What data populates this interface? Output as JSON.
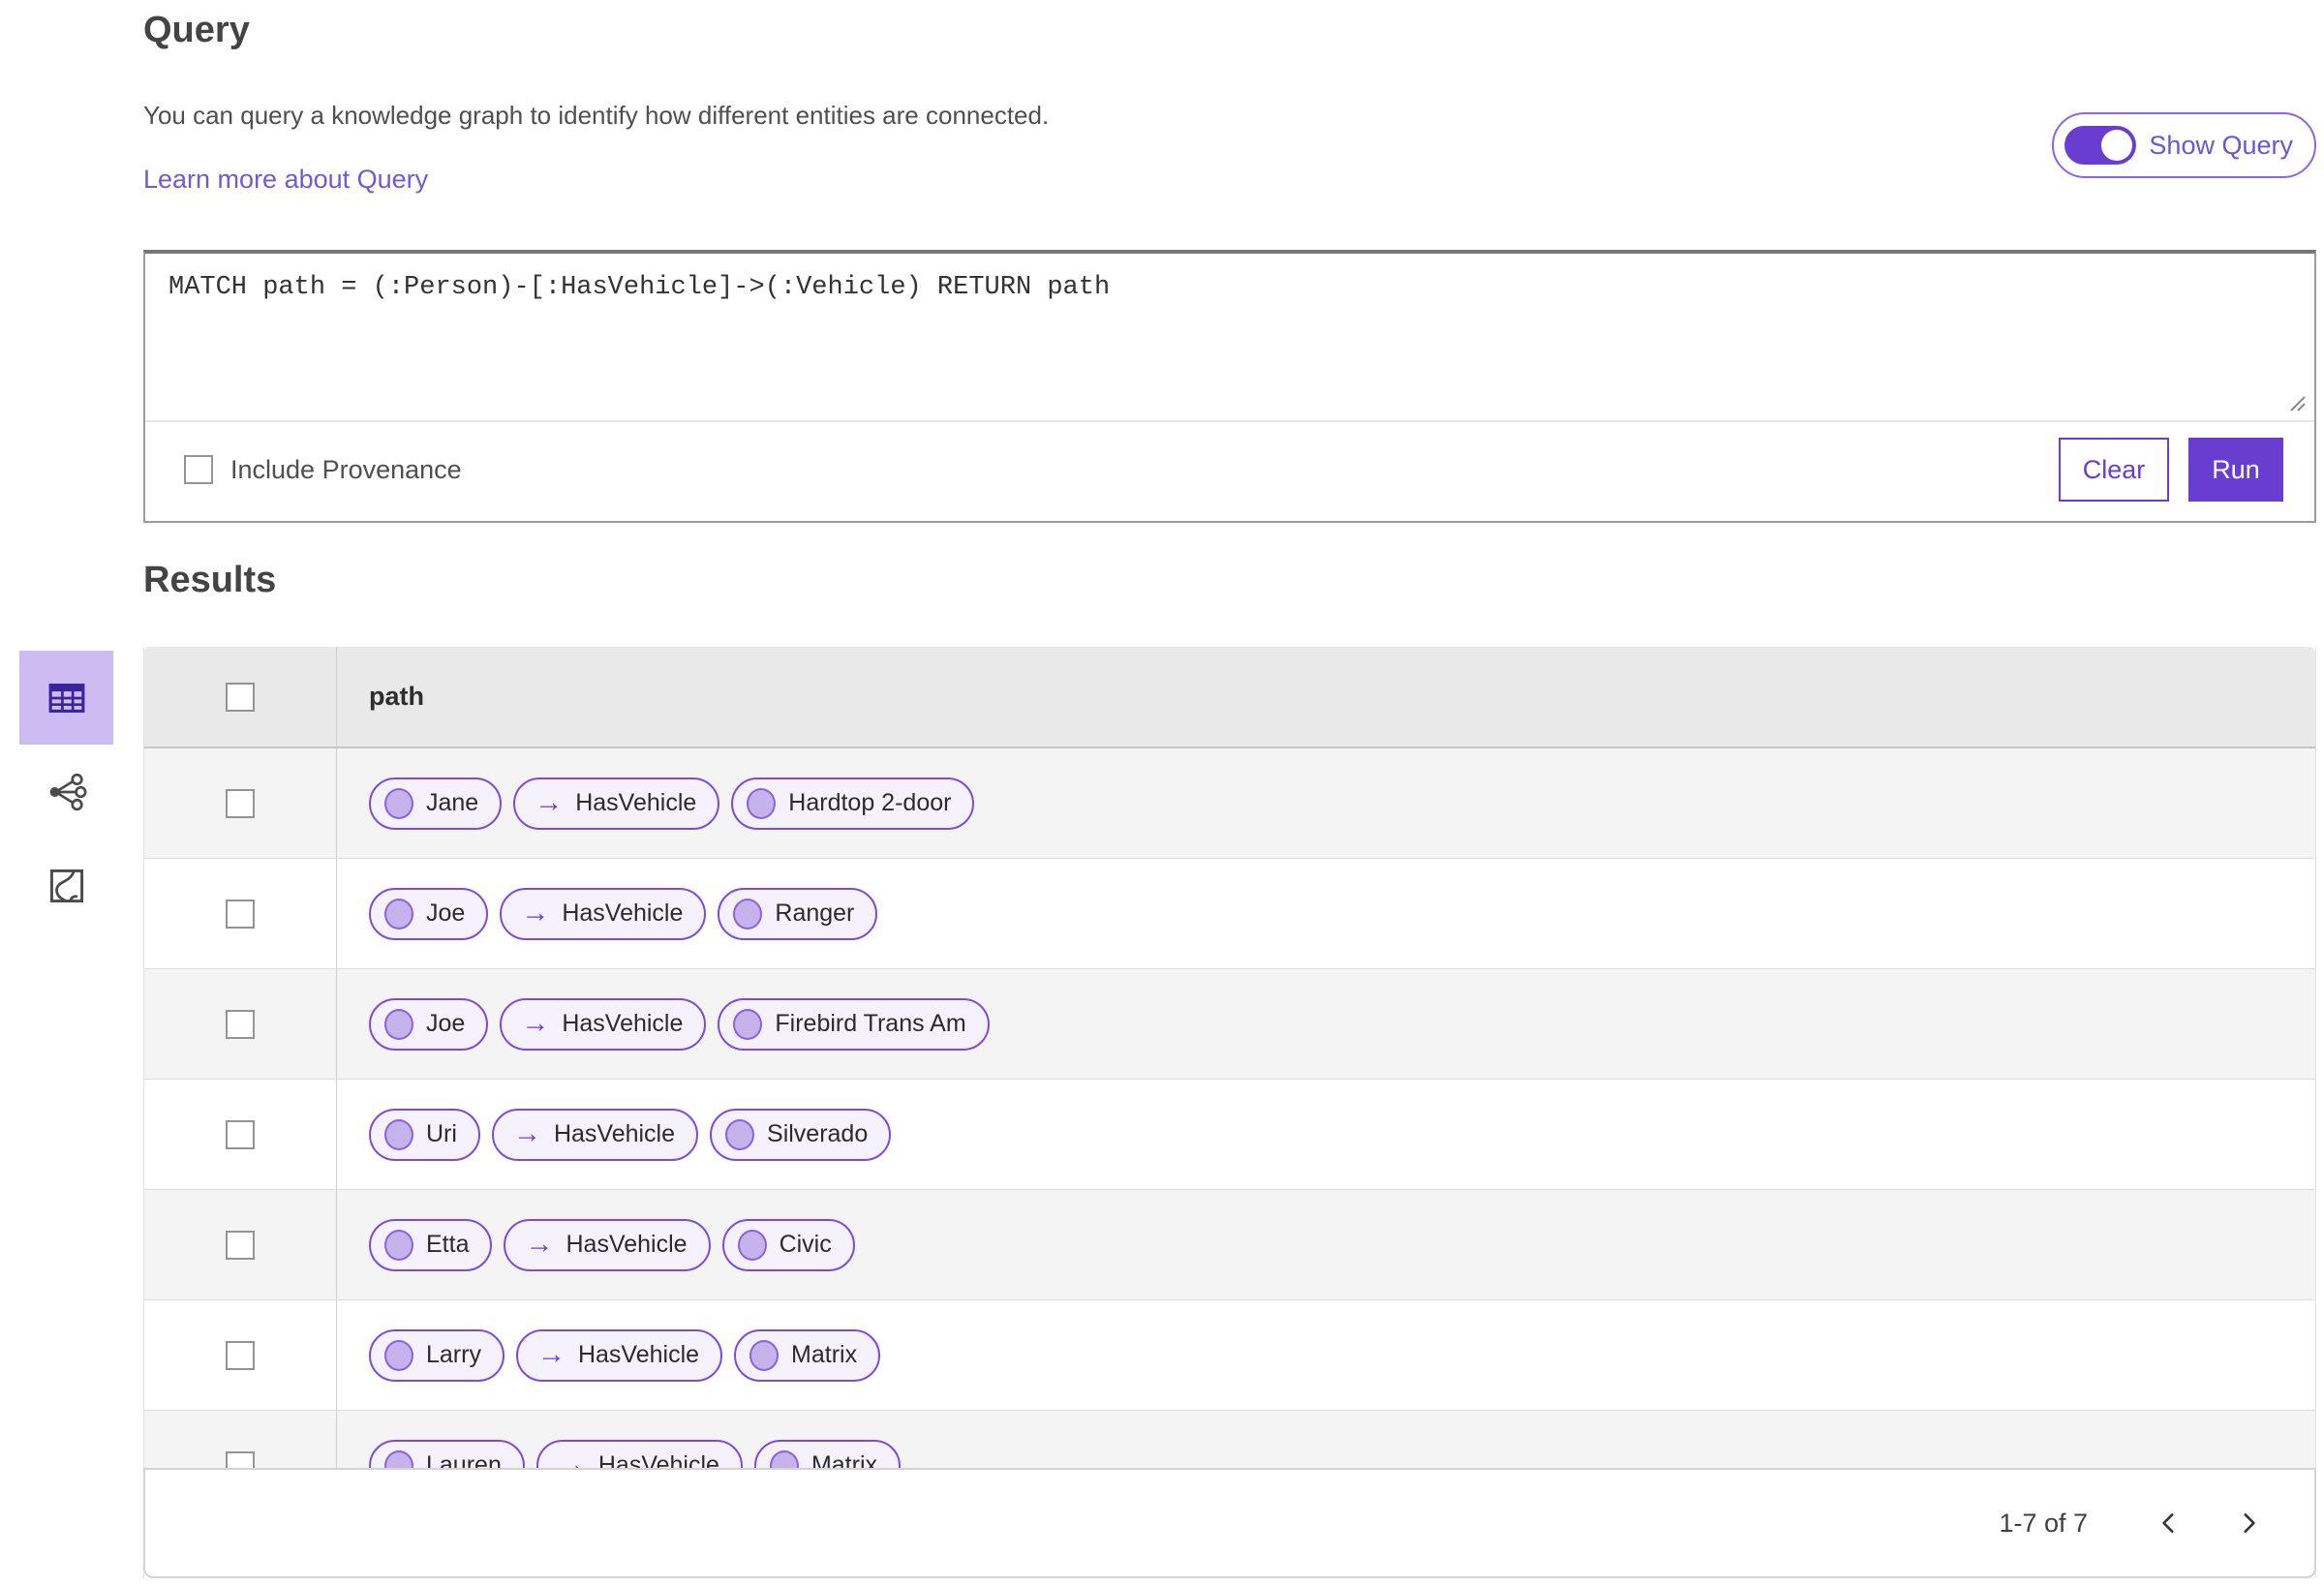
{
  "colors": {
    "brand": "#6a3dd1",
    "pill_border": "#7a4be0",
    "pill_bg": "#f5f2fd",
    "node_fill": "#c6b3ec",
    "selected_view_bg": "#cdbcf4",
    "link": "#6f5bd6"
  },
  "query": {
    "title": "Query",
    "description": "You can query a knowledge graph to identify how different entities are connected.",
    "learn_more_label": "Learn more about Query",
    "show_query_label": "Show Query",
    "show_query_on": true,
    "query_text": "MATCH path = (:Person)-[:HasVehicle]->(:Vehicle) RETURN path",
    "include_provenance_label": "Include Provenance",
    "include_provenance_checked": false,
    "clear_label": "Clear",
    "run_label": "Run"
  },
  "results": {
    "title": "Results",
    "views": [
      {
        "name": "table-view",
        "selected": true
      },
      {
        "name": "link-chart-view",
        "selected": false
      },
      {
        "name": "map-view",
        "selected": false
      }
    ],
    "column_header": "path",
    "edge_arrow": "→",
    "rows": [
      {
        "source": "Jane",
        "edge": "HasVehicle",
        "target": "Hardtop 2-door"
      },
      {
        "source": "Joe",
        "edge": "HasVehicle",
        "target": "Ranger"
      },
      {
        "source": "Joe",
        "edge": "HasVehicle",
        "target": "Firebird Trans Am"
      },
      {
        "source": "Uri",
        "edge": "HasVehicle",
        "target": "Silverado"
      },
      {
        "source": "Etta",
        "edge": "HasVehicle",
        "target": "Civic"
      },
      {
        "source": "Larry",
        "edge": "HasVehicle",
        "target": "Matrix"
      },
      {
        "source": "Lauren",
        "edge": "HasVehicle",
        "target": "Matrix"
      }
    ],
    "pagination": {
      "range_label": "1-7 of 7"
    }
  }
}
